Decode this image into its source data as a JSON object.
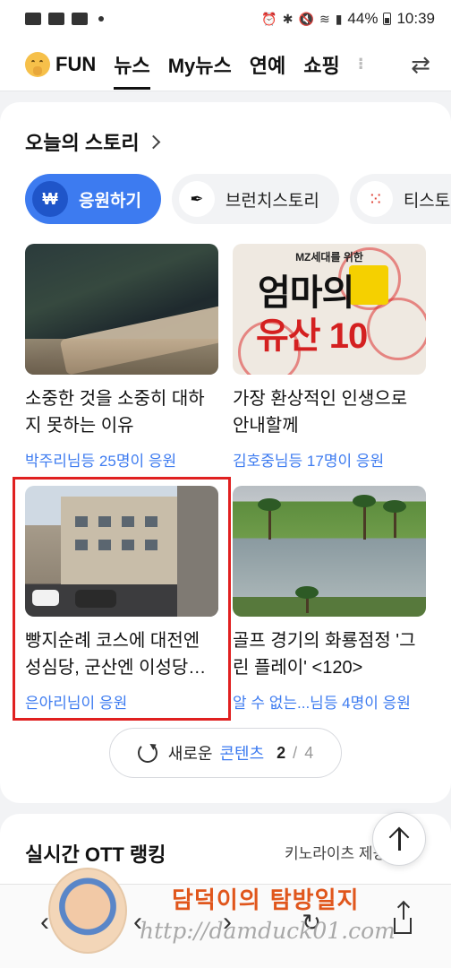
{
  "status_bar": {
    "battery": "44%",
    "time": "10:39"
  },
  "top_tabs": [
    {
      "label": "FUN",
      "active": false
    },
    {
      "label": "뉴스",
      "active": true
    },
    {
      "label": "My뉴스",
      "active": false
    },
    {
      "label": "연예",
      "active": false
    },
    {
      "label": "쇼핑",
      "active": false
    }
  ],
  "story": {
    "heading": "오늘의 스토리",
    "chips": [
      {
        "label": "응원하기",
        "icon": "won-icon",
        "active": true
      },
      {
        "label": "브런치스토리",
        "icon": "pen-icon",
        "active": false
      },
      {
        "label": "티스토리",
        "icon": "tistory-icon",
        "active": false
      }
    ],
    "items": [
      {
        "title": "소중한 것을 소중히 대하지 못하는 이유",
        "meta": "박주리님등 25명이 응원"
      },
      {
        "title": "가장 환상적인 인생으로 안내할께",
        "meta": "김호중님등 17명이 응원",
        "poster_small": "MZ세대를 위한",
        "poster_line1": "엄마의",
        "poster_line2": "유산 10"
      },
      {
        "title": "빵지순례 코스에 대전엔 성심당, 군산엔 이성당…",
        "meta": "은아리님이 응원"
      },
      {
        "title": "골프 경기의 화룡점정 '그린 플레이' <120>",
        "meta": "알 수 없는...님등 4명이 응원"
      }
    ],
    "more_button": {
      "prefix": "새로운 ",
      "accent": "콘텐츠",
      "current_page": "2",
      "separator": " / ",
      "total_pages": "4"
    }
  },
  "ott": {
    "heading": "실시간 OTT 랭킹",
    "sub": "키노라이츠 제공"
  },
  "watermark": {
    "title": "담덕이의 탐방일지",
    "url": "http://damduck01.com"
  },
  "colors": {
    "accent": "#3d7bf0",
    "selection": "#e02020"
  }
}
